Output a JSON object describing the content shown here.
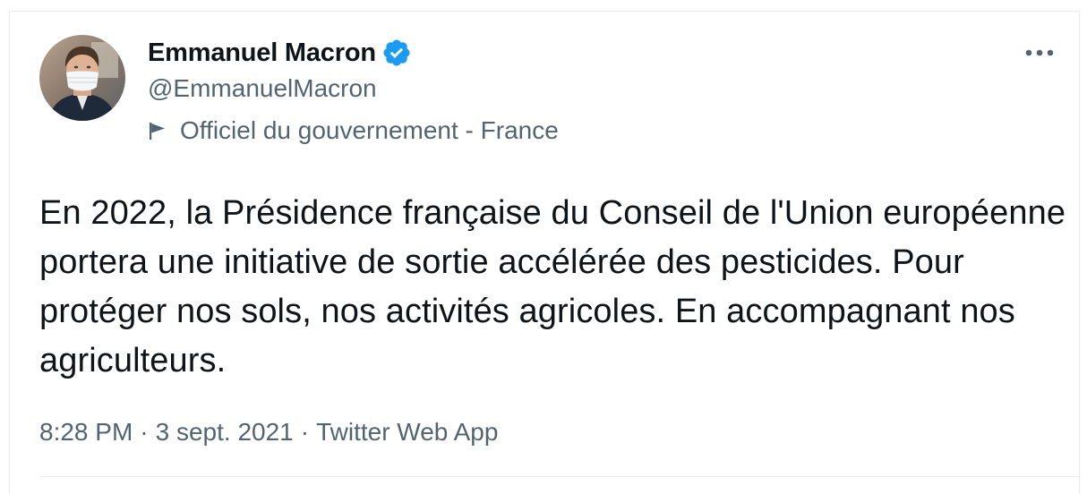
{
  "tweet": {
    "author": {
      "display_name": "Emmanuel Macron",
      "handle": "@EmmanuelMacron",
      "verified": true,
      "affiliation_label": "Officiel du gouvernement - France"
    },
    "text": "En 2022, la Présidence française du Conseil de l'Union européenne portera une initiative de sortie accélérée des pesticides. Pour protéger nos sols, nos activités agricoles. En accompagnant nos agriculteurs.",
    "time": "8:28 PM",
    "separator": "·",
    "date": "3 sept. 2021",
    "source": "Twitter Web App"
  },
  "colors": {
    "text_primary": "#0f1419",
    "text_secondary": "#536471",
    "verified_blue": "#1d9bf0",
    "border": "#e6ecf0"
  },
  "icons": {
    "verified": "verified-badge-icon",
    "affiliation": "flag-icon",
    "more": "more-options-icon"
  }
}
